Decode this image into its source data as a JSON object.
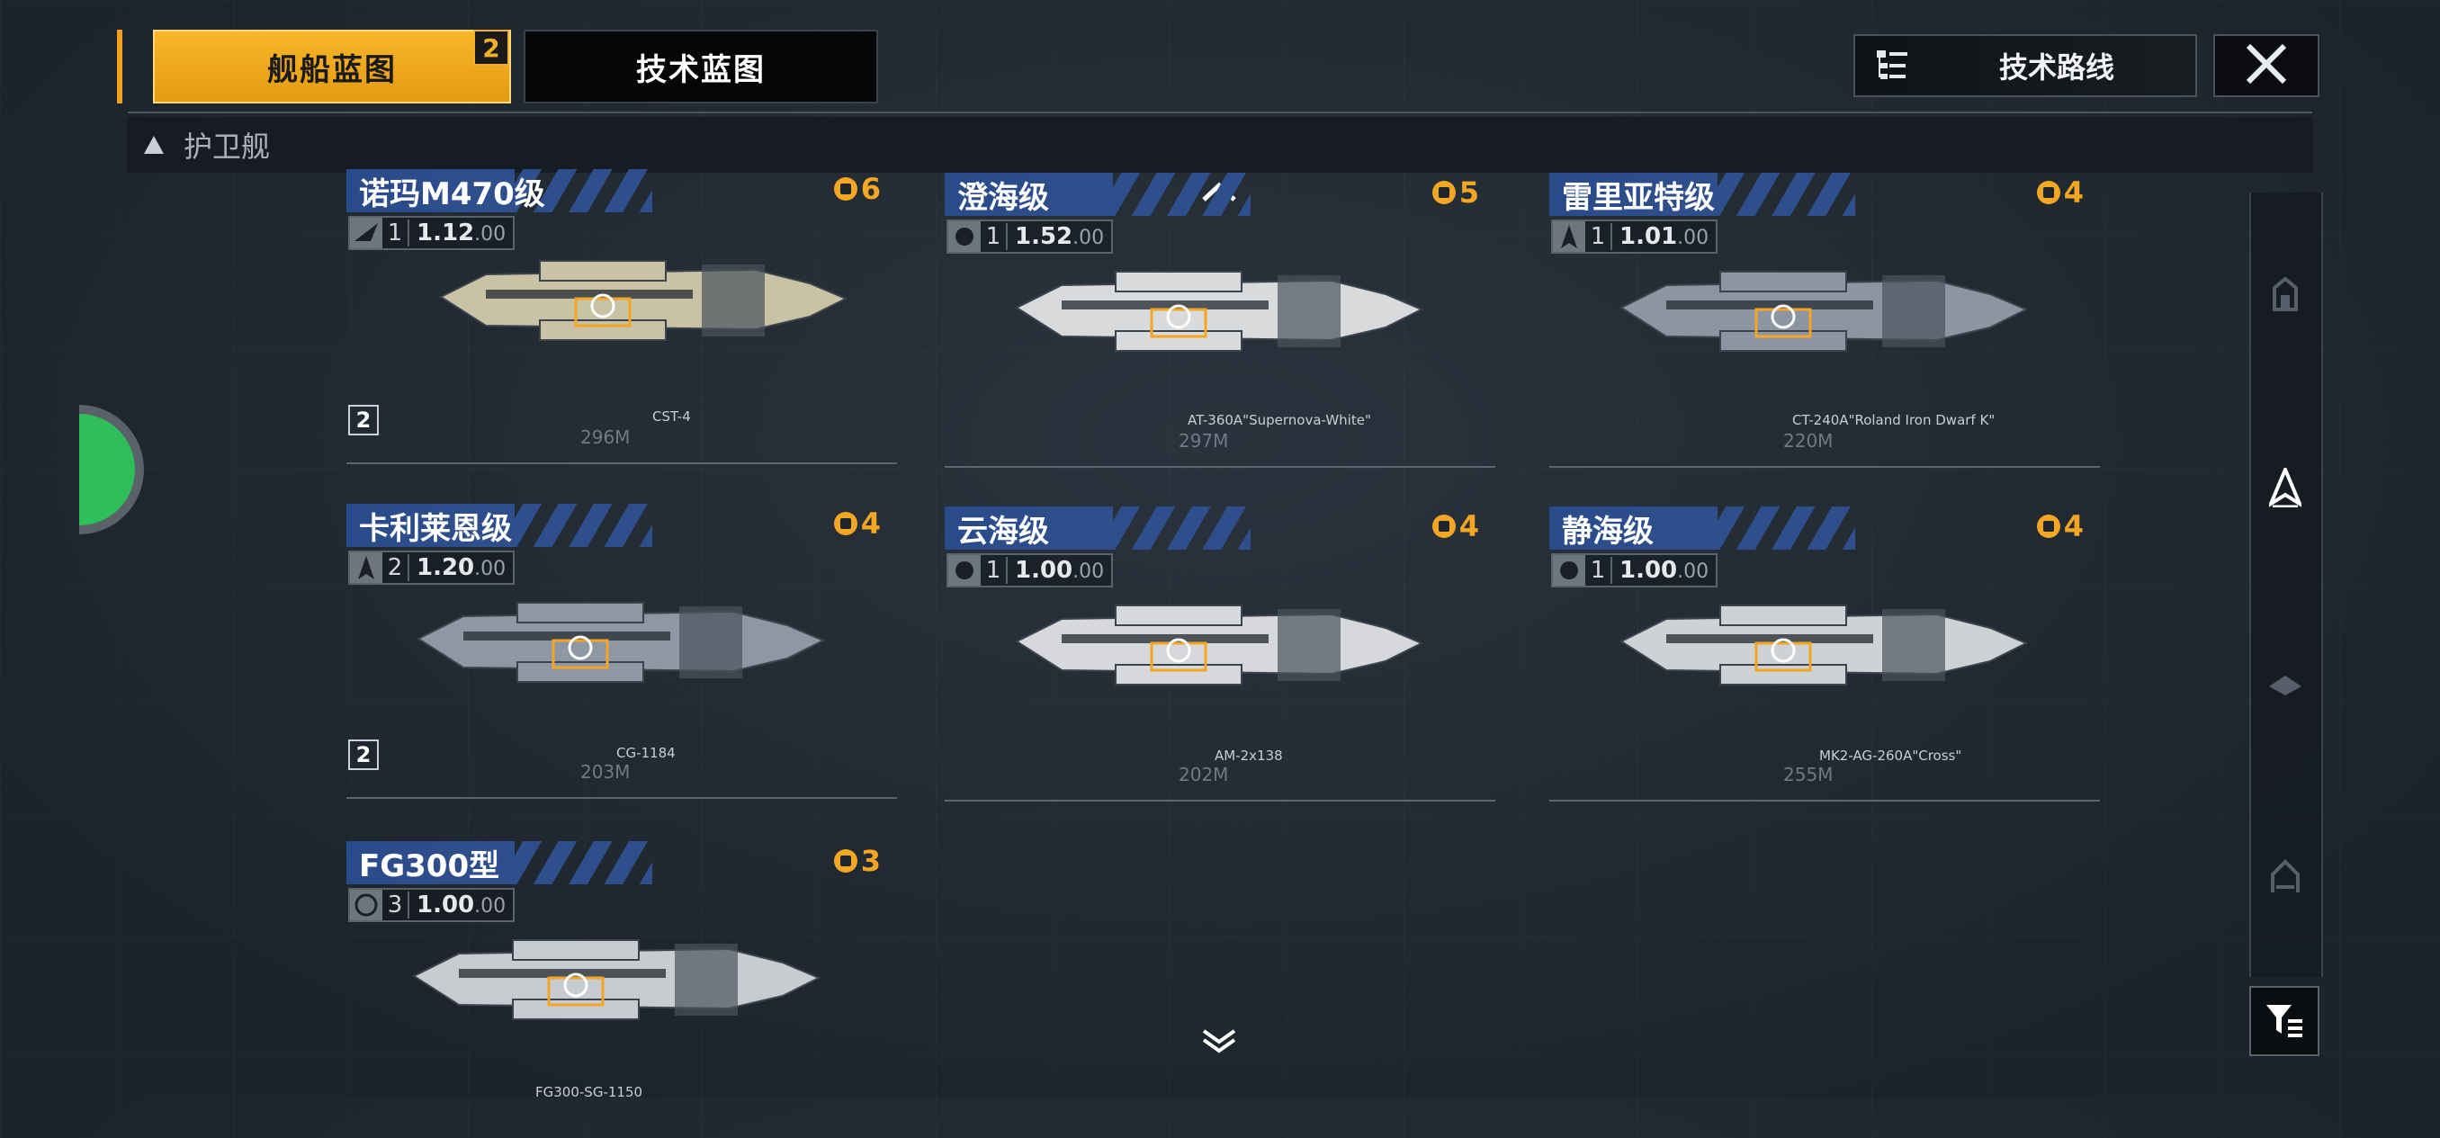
{
  "tabs": {
    "ships_label": "舰船蓝图",
    "ships_badge": "2",
    "tech_label": "技术蓝图"
  },
  "header": {
    "tech_route_label": "技术路线"
  },
  "category": {
    "label": "护卫舰"
  },
  "ships": [
    {
      "name": "诺玛M470级",
      "cost": "6",
      "level": "1",
      "value_main": "1.12",
      "value_dec": ".00",
      "weapon": "CST-4",
      "owned": "2",
      "scale": "296M"
    },
    {
      "name": "澄海级",
      "cost": "5",
      "level": "1",
      "value_main": "1.52",
      "value_dec": ".00",
      "weapon": "AT-360A\"Supernova-White\"",
      "owned": "",
      "scale": "297M"
    },
    {
      "name": "雷里亚特级",
      "cost": "4",
      "level": "1",
      "value_main": "1.01",
      "value_dec": ".00",
      "weapon": "CT-240A\"Roland Iron Dwarf K\"",
      "owned": "",
      "scale": "220M"
    },
    {
      "name": "卡利莱恩级",
      "cost": "4",
      "level": "2",
      "value_main": "1.20",
      "value_dec": ".00",
      "weapon": "CG-1184",
      "owned": "2",
      "scale": "203M"
    },
    {
      "name": "云海级",
      "cost": "4",
      "level": "1",
      "value_main": "1.00",
      "value_dec": ".00",
      "weapon": "AM-2x138",
      "owned": "",
      "scale": "202M"
    },
    {
      "name": "静海级",
      "cost": "4",
      "level": "1",
      "value_main": "1.00",
      "value_dec": ".00",
      "weapon": "MK2-AG-260A\"Cross\"",
      "owned": "",
      "scale": "255M"
    },
    {
      "name": "FG300型",
      "cost": "3",
      "level": "3",
      "value_main": "1.00",
      "value_dec": ".00",
      "weapon": "FG300-SG-1150",
      "owned": "",
      "scale": ""
    }
  ],
  "icons": {
    "filter": "filter-icon",
    "close": "close-icon",
    "tech_route": "tree-list-icon"
  },
  "colors": {
    "accent": "#f2a623",
    "name_bar": "#2f4f8c"
  }
}
